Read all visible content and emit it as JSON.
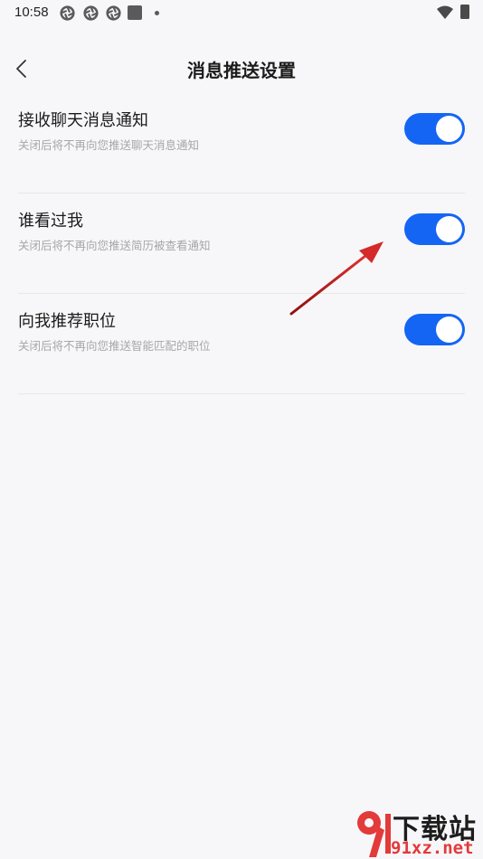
{
  "status_bar": {
    "time": "10:58",
    "icons": [
      "aperture-icon",
      "aperture-icon",
      "aperture-icon",
      "notification-square-icon",
      "notification-dot-icon",
      "wifi-icon",
      "battery-icon"
    ]
  },
  "header": {
    "back_icon": "chevron-left-icon",
    "title": "消息推送设置"
  },
  "settings": [
    {
      "title": "接收聊天消息通知",
      "description": "关闭后将不再向您推送聊天消息通知",
      "enabled": true
    },
    {
      "title": "谁看过我",
      "description": "关闭后将不再向您推送简历被查看通知",
      "enabled": true
    },
    {
      "title": "向我推荐职位",
      "description": "关闭后将不再向您推送智能匹配的职位",
      "enabled": true
    }
  ],
  "colors": {
    "background": "#f7f7f9",
    "toggle_on": "#1565f5",
    "annotation_arrow": "#d42a2a",
    "watermark_red": "#e33a3a"
  },
  "watermark": {
    "title": "下载站",
    "url": "91xz.net"
  }
}
